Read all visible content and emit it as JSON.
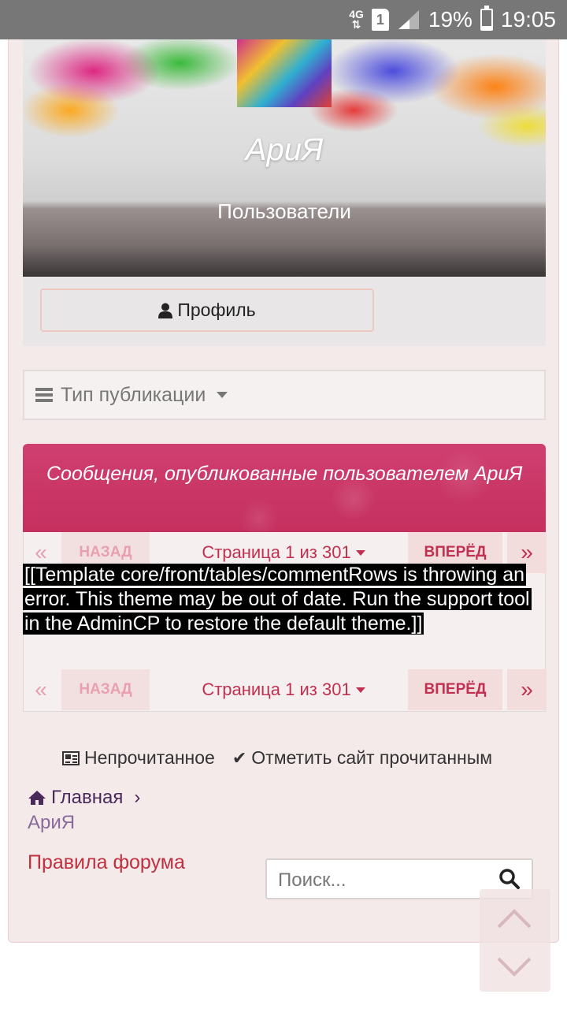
{
  "status_bar": {
    "network": "4G",
    "sim": "1",
    "battery": "19%",
    "time": "19:05"
  },
  "hero": {
    "name": "АриЯ",
    "subtitle": "Пользователи"
  },
  "profile": {
    "button_label": "Профиль"
  },
  "filter": {
    "label": "Тип публикации"
  },
  "posts": {
    "title": "Сообщения, опубликованные пользователем АриЯ"
  },
  "pagination": {
    "first": "«",
    "prev": "НАЗАД",
    "current": "Страница 1 из 301",
    "next": "ВПЕРЁД",
    "last": "»"
  },
  "error": {
    "message": "[[Template core/front/tables/commentRows is throwing an error. This theme may be out of date. Run the support tool in the AdminCP to restore the default theme.]]"
  },
  "footer_links": {
    "unread": "Непрочитанное",
    "mark_read": "Отметить сайт прочитанным"
  },
  "breadcrumb": {
    "home": "Главная",
    "separator": "›",
    "current": "АриЯ"
  },
  "rules_link": "Правила форума",
  "search": {
    "placeholder": "Поиск..."
  },
  "colors": {
    "accent": "#c5305f",
    "page_bg": "#f4eaea",
    "link": "#c03040"
  }
}
